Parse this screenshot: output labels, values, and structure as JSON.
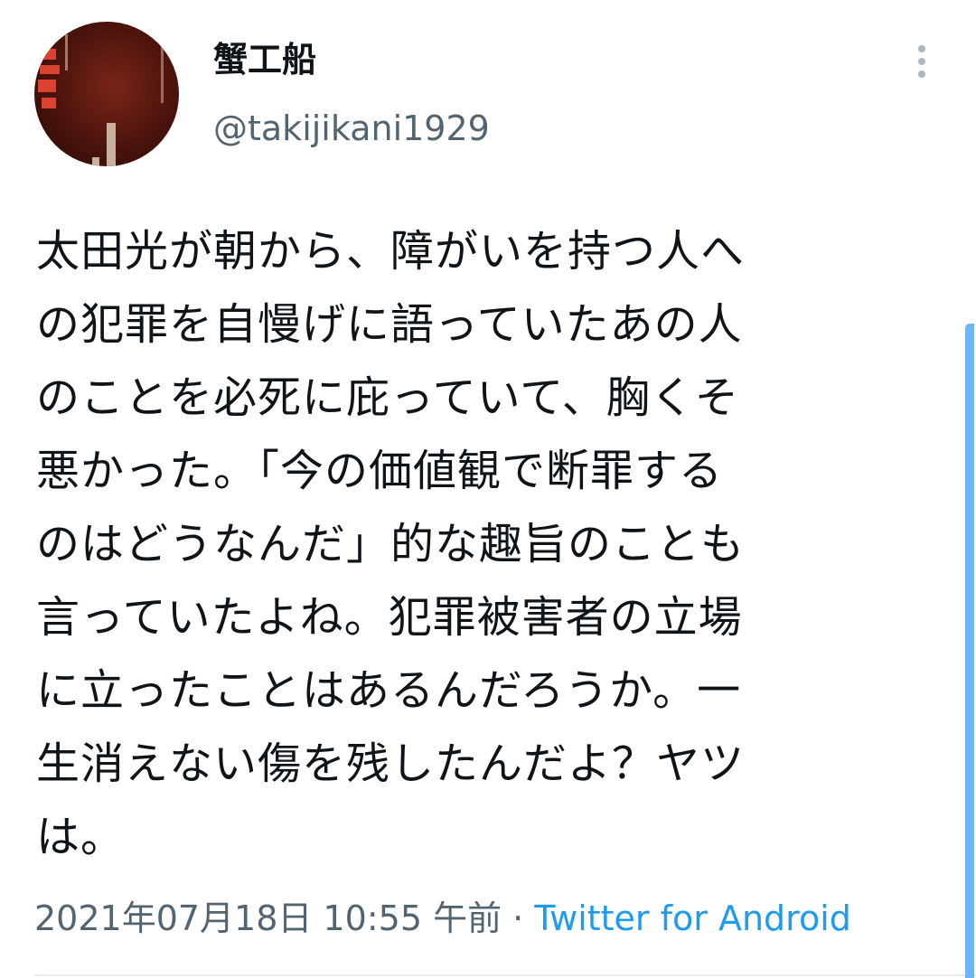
{
  "tweet": {
    "author": {
      "display_name": "蟹工船",
      "handle": "@takijikani1929",
      "avatar_icon": "book-cover-avatar"
    },
    "text": "太田光が朝から、障がいを持つ人へ\nの犯罪を自慢げに語っていたあの人\nのことを必死に庇っていて、胸くそ\n悪かった。「今の価値観で断罪する\nのはどうなんだ」的な趣旨のことも\n言っていたよね。犯罪被害者の立場\nに立ったことはあるんだろうか。一\n生消えない傷を残したんだよ？ヤツ\nは。",
    "timestamp": "2021年07月18日 10:55 午前",
    "separator": "·",
    "source": "Twitter for Android"
  },
  "colors": {
    "text": "#0f1419",
    "secondary": "#536471",
    "link": "#1d9bf0",
    "scrollbar": "#6cb6f5"
  },
  "icons": {
    "more": "more-vertical-icon"
  }
}
